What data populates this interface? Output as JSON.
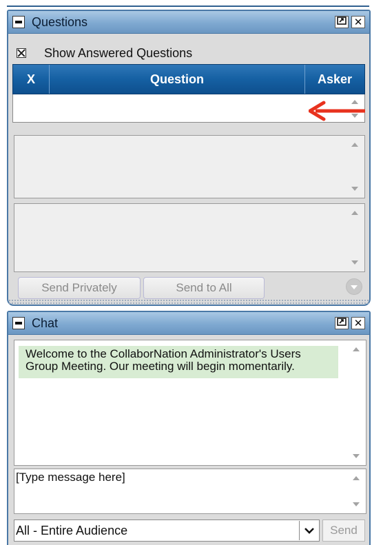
{
  "questions_panel": {
    "title": "Questions",
    "show_answered_label": "Show Answered Questions",
    "show_answered_checked": true,
    "columns": [
      "X",
      "Question",
      "Asker"
    ],
    "send_privately_label": "Send Privately",
    "send_to_all_label": "Send to All"
  },
  "chat_panel": {
    "title": "Chat",
    "welcome_message": "Welcome to the CollaborNation Administrator's Users Group Meeting. Our meeting will begin momentarily.",
    "input_placeholder": "[Type message here]",
    "audience_selected": "All - Entire Audience",
    "send_label": "Send"
  },
  "icons": {
    "collapse": "minus-icon",
    "popout": "popout-icon",
    "close": "close-icon",
    "annotation_arrow": "left-arrow-icon"
  },
  "colors": {
    "header_blue": "#7fa9d1",
    "table_header": "#1560a3",
    "welcome_bg": "#d8ecd3",
    "annotation_arrow": "#e8321e"
  }
}
